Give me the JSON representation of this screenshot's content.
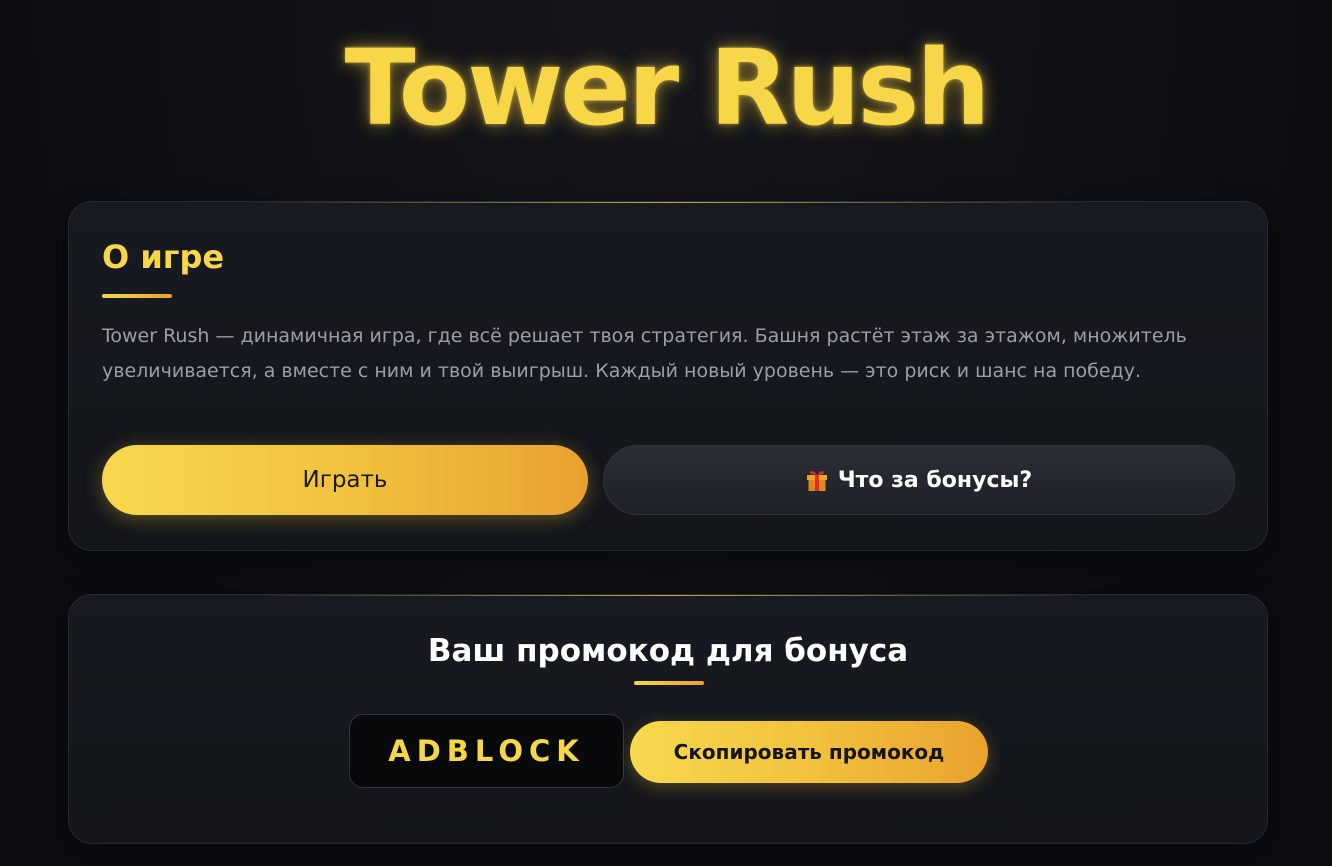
{
  "header": {
    "title": "Tower Rush"
  },
  "about": {
    "heading": "О игре",
    "text": "Tower Rush — динамичная игра, где всё решает твоя стратегия. Башня растёт этаж за этажом, множитель увеличивается, а вместе с ним и твой выигрыш. Каждый новый уровень — это риск и шанс на победу.",
    "play_button": "Играть",
    "bonus_button": "Что за бонусы?",
    "bonus_icon": "gift-icon"
  },
  "promo": {
    "heading": "Ваш промокод для бонуса",
    "code": "ADBLOCK",
    "copy_button": "Скопировать промокод"
  },
  "colors": {
    "background": "#0b0d11",
    "accent": "#f7d648",
    "accent_dark": "#e9a22e",
    "card": "#171a20",
    "text_muted": "#9a9ea8"
  }
}
